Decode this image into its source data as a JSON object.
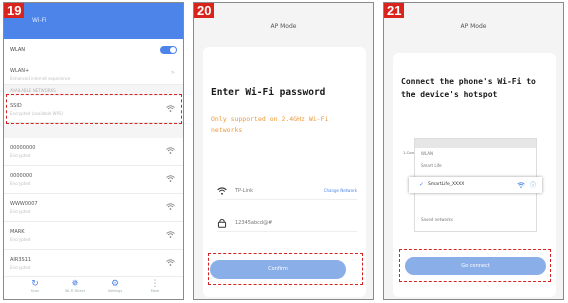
{
  "steps": {
    "s19": "19",
    "s20": "20",
    "s21": "21"
  },
  "panel19": {
    "header_title": "Wi-Fi",
    "wlan_label": "WLAN",
    "connected_name": "WLAN+",
    "connected_sub": "Enhanced internet experience",
    "section_label": "AVAILABLE NETWORKS",
    "networks": [
      {
        "name": "SSID",
        "sub": "Encrypted (available WPS)"
      },
      {
        "name": "00000000",
        "sub": "Encrypted"
      },
      {
        "name": "0000000",
        "sub": "Encrypted"
      },
      {
        "name": "WWW0007",
        "sub": "Encrypted"
      },
      {
        "name": "MARK",
        "sub": "Encrypted"
      },
      {
        "name": "AIR3S11",
        "sub": "Encrypted"
      }
    ],
    "bottom": [
      {
        "label": "Scan",
        "icon": "refresh-icon"
      },
      {
        "label": "Wi-Fi Direct",
        "icon": "wifi-direct-icon"
      },
      {
        "label": "Settings",
        "icon": "gear-icon"
      },
      {
        "label": "More",
        "icon": "more-icon"
      }
    ]
  },
  "panel20": {
    "title": "AP Mode",
    "heading": "Enter Wi-Fi password",
    "note": "Only supported on 2.4GHz Wi-Fi networks",
    "ssid": "TP-Link",
    "change_link": "Change Network",
    "password": "12345abcd@#",
    "button": "Confirm"
  },
  "panel21": {
    "title": "AP Mode",
    "heading": "Connect the phone's Wi-Fi to the device's hotspot",
    "instruction": "1.Connected phone to the hotspot shown below",
    "phone_rows": [
      "WLAN",
      "Smart Life"
    ],
    "hotspot": "SmartLife_XXXX",
    "saved_row": "Saved networks",
    "button": "Go connect"
  },
  "colors": {
    "accent": "#4d84ea",
    "step_red": "#d9241d",
    "note_orange": "#ee9a3a"
  }
}
